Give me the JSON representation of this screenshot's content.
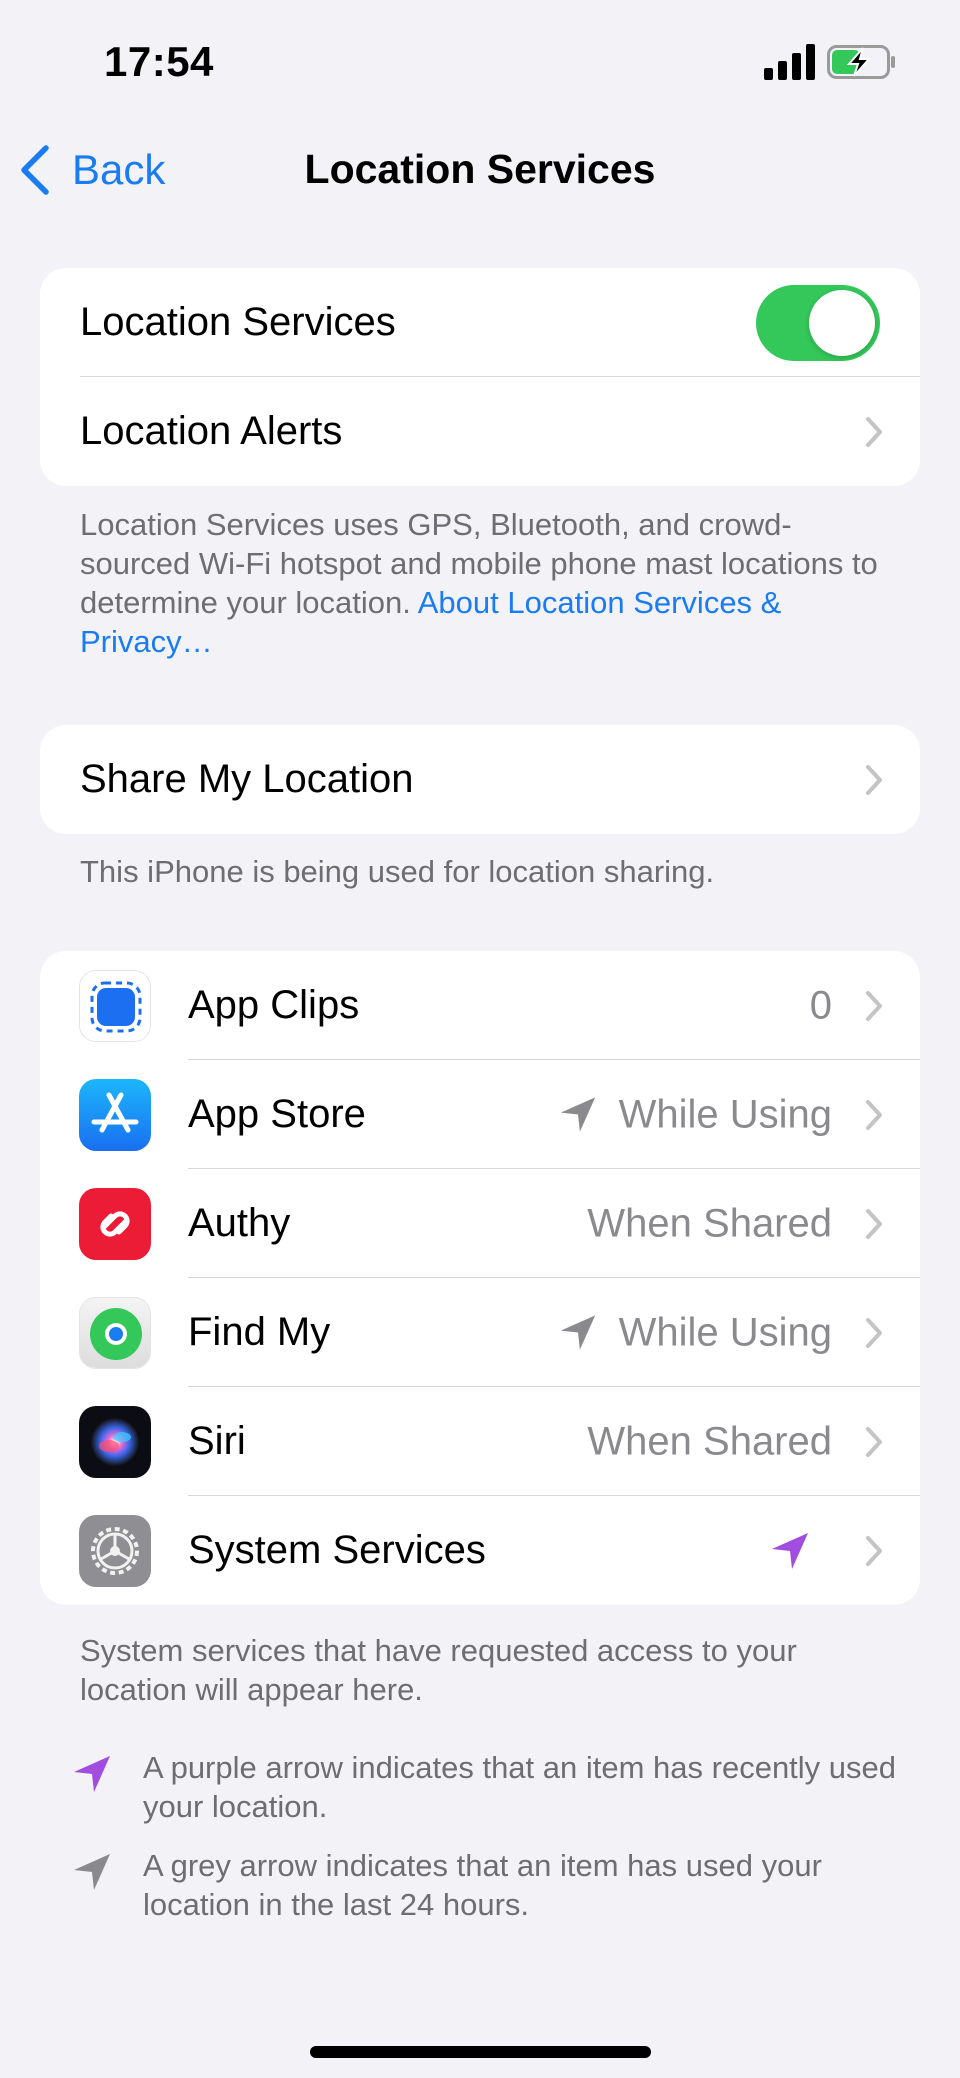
{
  "status_bar": {
    "time": "17:54"
  },
  "nav": {
    "back_label": "Back",
    "title": "Location Services"
  },
  "location_group": {
    "toggle_row_label": "Location Services",
    "toggle_on": true,
    "alerts_label": "Location Alerts"
  },
  "location_note": {
    "text": "Location Services uses GPS, Bluetooth, and crowd-sourced Wi-Fi hotspot and mobile phone mast locations to determine your location. ",
    "link": "About Location Services & Privacy…"
  },
  "share_group": {
    "label": "Share My Location"
  },
  "share_note": "This iPhone is being used for location sharing.",
  "apps": [
    {
      "name": "App Clips",
      "value": "0",
      "arrow": "none",
      "icon": "app-clips-icon"
    },
    {
      "name": "App Store",
      "value": "While Using",
      "arrow": "grey",
      "icon": "app-store-icon"
    },
    {
      "name": "Authy",
      "value": "When Shared",
      "arrow": "none",
      "icon": "authy-icon"
    },
    {
      "name": "Find My",
      "value": "While Using",
      "arrow": "grey",
      "icon": "find-my-icon"
    },
    {
      "name": "Siri",
      "value": "When Shared",
      "arrow": "none",
      "icon": "siri-icon"
    },
    {
      "name": "System Services",
      "value": "",
      "arrow": "purple",
      "icon": "settings-gear-icon"
    }
  ],
  "system_note": "System services that have requested access to your location will appear here.",
  "legend": {
    "purple": "A purple arrow indicates that an item has recently used your location.",
    "grey": "A grey arrow indicates that an item has used your location in the last 24 hours."
  },
  "colors": {
    "accent": "#1a7cf2",
    "toggle_on": "#34c759",
    "purple_arrow": "#a14de0",
    "grey_arrow": "#8a8a8e",
    "background": "#f2f2f7"
  }
}
